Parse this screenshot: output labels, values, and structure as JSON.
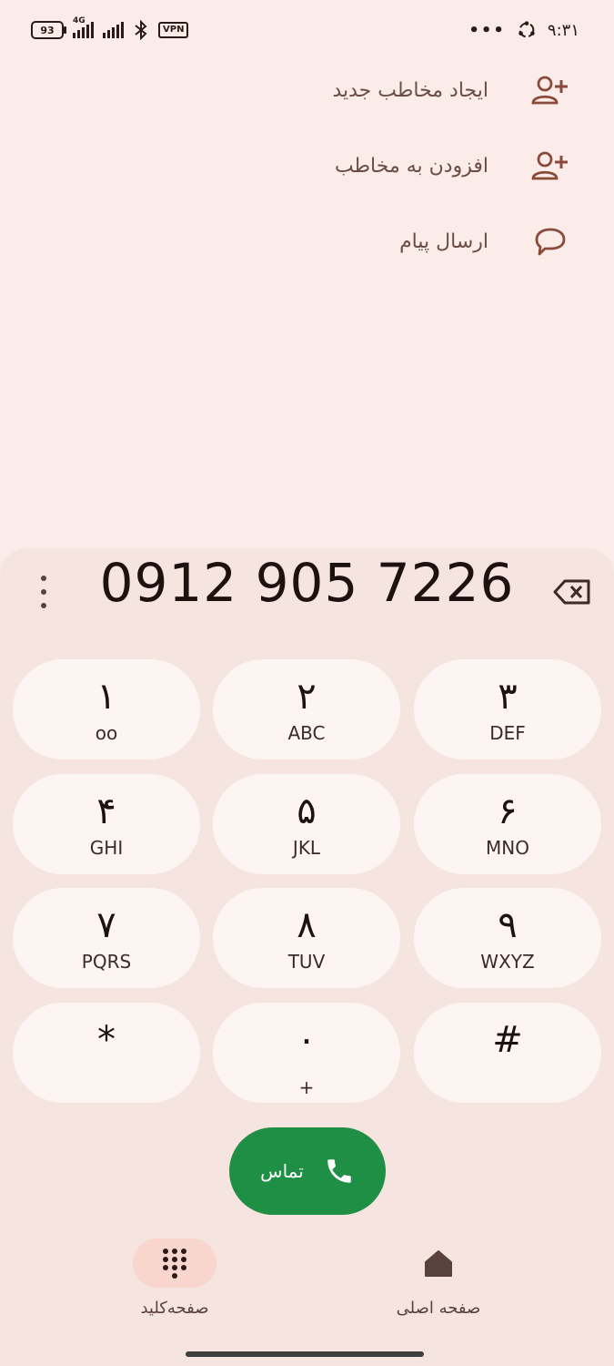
{
  "status_bar": {
    "battery": "93",
    "network": "4G",
    "vpn": "VPN",
    "time": "۹:۳۱",
    "more": "•••"
  },
  "actions": [
    {
      "label": "ایجاد مخاطب جدید",
      "icon": "person-add-icon"
    },
    {
      "label": "افزودن به مخاطب",
      "icon": "person-add-icon"
    },
    {
      "label": "ارسال پیام",
      "icon": "message-icon"
    }
  ],
  "dialer": {
    "number": "0912 905 7226",
    "keys": [
      {
        "digit": "۱",
        "sub": "oo"
      },
      {
        "digit": "۲",
        "sub": "ABC"
      },
      {
        "digit": "۳",
        "sub": "DEF"
      },
      {
        "digit": "۴",
        "sub": "GHI"
      },
      {
        "digit": "۵",
        "sub": "JKL"
      },
      {
        "digit": "۶",
        "sub": "MNO"
      },
      {
        "digit": "۷",
        "sub": "PQRS"
      },
      {
        "digit": "۸",
        "sub": "TUV"
      },
      {
        "digit": "۹",
        "sub": "WXYZ"
      },
      {
        "digit": "*",
        "sub": ""
      },
      {
        "digit": "۰",
        "sub": "+"
      },
      {
        "digit": "#",
        "sub": ""
      }
    ],
    "call_label": "تماس"
  },
  "nav": {
    "keypad_label": "صفحه‌کلید",
    "home_label": "صفحه اصلی"
  },
  "colors": {
    "background": "#fbece9",
    "call_green": "#1f8f46",
    "accent_icon": "#8a4a3a"
  }
}
